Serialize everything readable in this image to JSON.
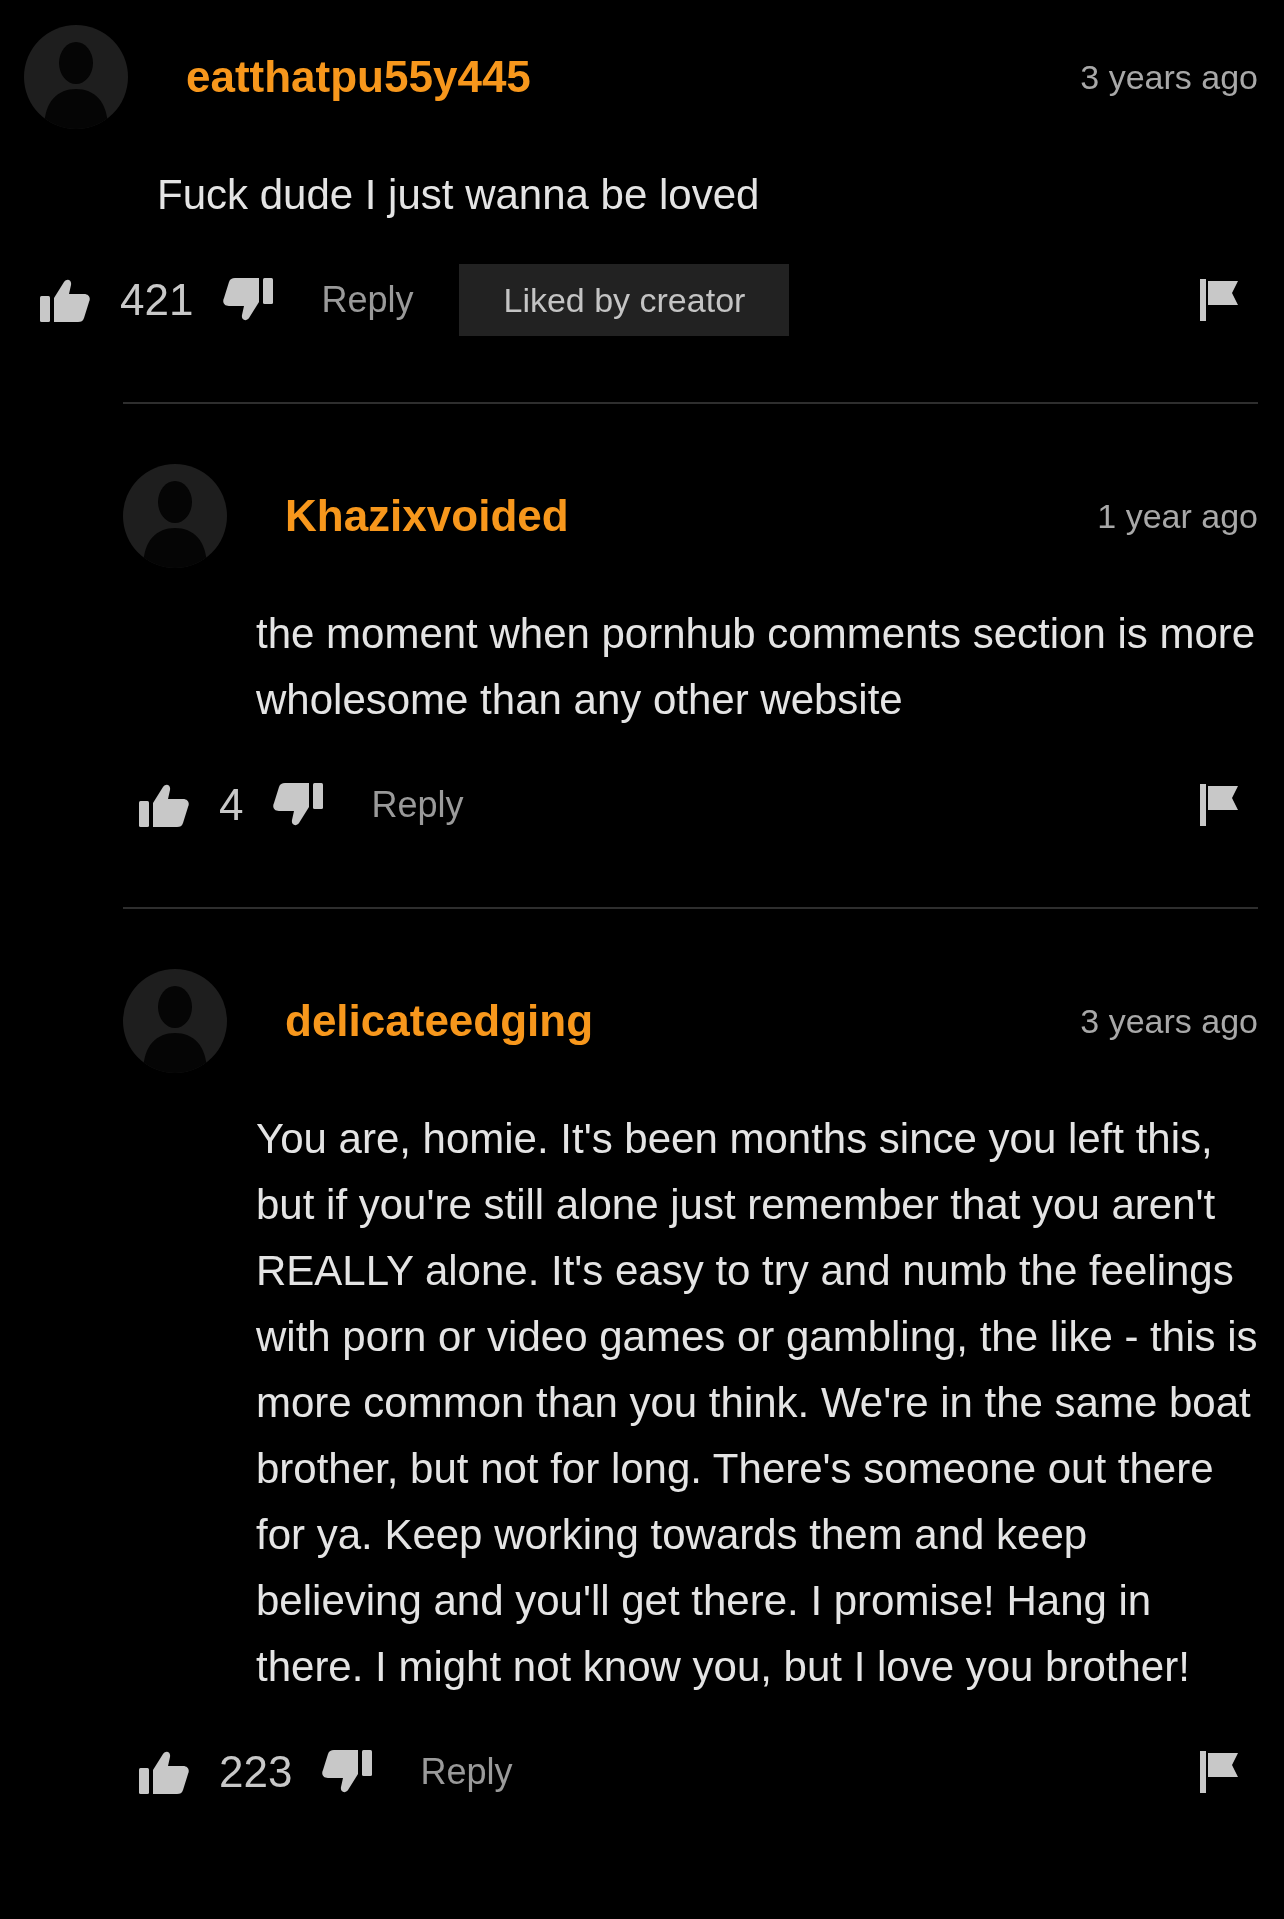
{
  "comments": [
    {
      "username": "eatthatpu55y445",
      "time": "3 years ago",
      "text": "Fuck dude I just wanna be loved",
      "likes": "421",
      "reply": "Reply",
      "badge": "Liked by creator",
      "children": [
        {
          "username": "Khazixvoided",
          "time": "1 year ago",
          "text": "the moment when pornhub comments section is more wholesome than any other website",
          "likes": "4",
          "reply": "Reply"
        },
        {
          "username": "delicateedging",
          "time": "3 years ago",
          "text": "You are, homie. It's been months since you left this, but if you're still alone just remember that you aren't REALLY alone. It's easy to try and numb the feelings with porn or video games or gambling, the like - this is more common than you think. We're in the same boat brother, but not for long. There's someone out there for ya. Keep working towards them and keep believing and you'll get there. I promise! Hang in there. I might not know you, but I love you brother!",
          "likes": "223",
          "reply": "Reply"
        }
      ]
    }
  ]
}
